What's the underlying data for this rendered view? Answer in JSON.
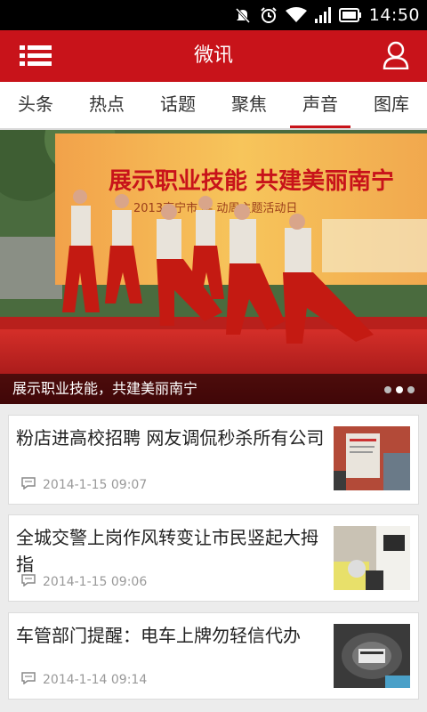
{
  "status_bar": {
    "time": "14:50",
    "icons": [
      "mute-icon",
      "alarm-icon",
      "wifi-icon",
      "signal-icon",
      "battery-icon"
    ]
  },
  "header": {
    "title": "微讯",
    "menu_icon": "menu-icon",
    "user_icon": "user-icon",
    "background": "#c8131a"
  },
  "tabs": [
    {
      "label": "头条",
      "active": false
    },
    {
      "label": "热点",
      "active": false
    },
    {
      "label": "话题",
      "active": false
    },
    {
      "label": "聚焦",
      "active": false
    },
    {
      "label": "声音",
      "active": true
    },
    {
      "label": "图库",
      "active": false
    }
  ],
  "hero": {
    "caption": "展示职业技能，共建美丽南宁",
    "banner_text": "展示职业技能  共建美丽南宁",
    "banner_sub": "2013南宁市 学 动周主题活动日",
    "slide_count": 3,
    "active_slide": 1
  },
  "news": [
    {
      "title": "粉店进高校招聘 网友调侃秒杀所有公司",
      "time": "2014-1-15 09:07",
      "icon": "comment-icon"
    },
    {
      "title": "全城交警上岗作风转变让市民竖起大拇指",
      "time": "2014-1-15 09:06",
      "icon": "comment-icon"
    },
    {
      "title": "车管部门提醒：电车上牌勿轻信代办",
      "time": "2014-1-14 09:14",
      "icon": "comment-icon"
    }
  ]
}
